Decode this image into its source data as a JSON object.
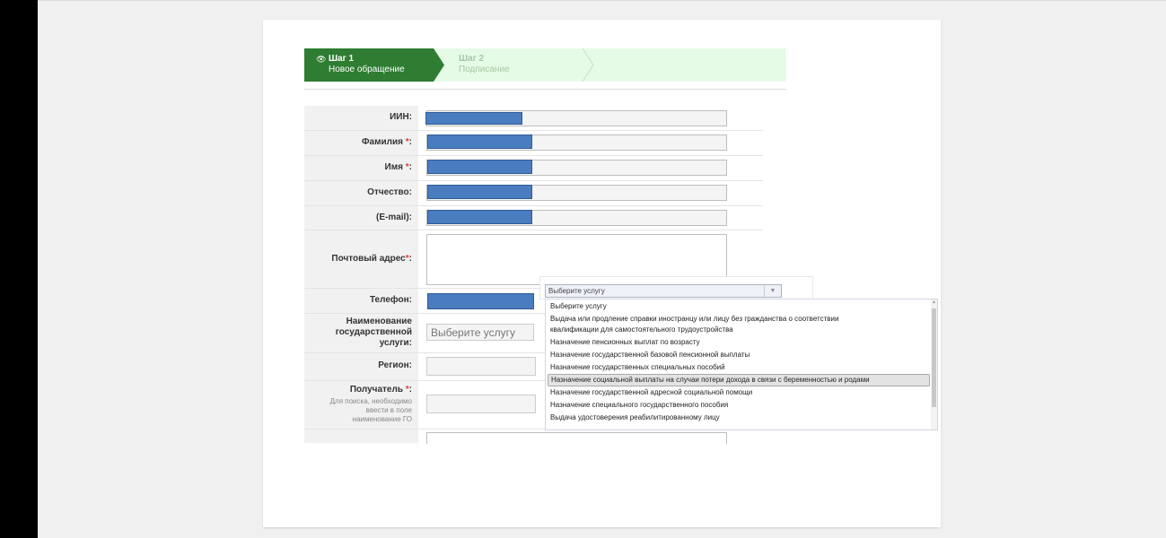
{
  "steps": [
    {
      "title": "Шаг 1",
      "subtitle": "Новое обращение",
      "active": true
    },
    {
      "title": "Шаг 2",
      "subtitle": "Подписание",
      "active": false
    }
  ],
  "form": {
    "iin_label": "ИИН:",
    "lastname_label": "Фамилия",
    "firstname_label": "Имя",
    "middlename_label": "Отчество:",
    "email_label": "(E-mail):",
    "address_label": "Почтовый адрес",
    "phone_label": "Телефон:",
    "service_label_1": "Наименование",
    "service_label_2": "государственной",
    "service_label_3": "услуги:",
    "service_value": "Выберите услугу",
    "region_label": "Регион:",
    "recipient_label": "Получатель",
    "recipient_hint_1": "Для поиска, необходимо",
    "recipient_hint_2": "ввести в поле",
    "recipient_hint_3": "наименование ГО",
    "required_mark": "*",
    "colon": ":"
  },
  "dropdown": {
    "search_value": "Выберите услугу",
    "items": [
      "Выберите услугу",
      "Выдача или продление справки иностранцу или лицу без гражданства о соответствии",
      "квалификации для самостоятельного трудоустройства",
      "Назначение пенсионных выплат по возрасту",
      "Назначение государственной базовой пенсионной выплаты",
      "Назначение государственных специальных пособий",
      "Назначение социальной выплаты на случаи потери дохода в связи с беременностью и родами",
      "Назначение государственной адресной социальной помощи",
      "Назначение специального государственного пособия",
      "Выдача удостоверения реабилитированному лицу"
    ],
    "highlighted_index": 6
  },
  "colors": {
    "step_active": "#2e7d32",
    "step_bar": "#e6fbe6",
    "required": "#e53935",
    "redaction": "#4a7cc0"
  }
}
